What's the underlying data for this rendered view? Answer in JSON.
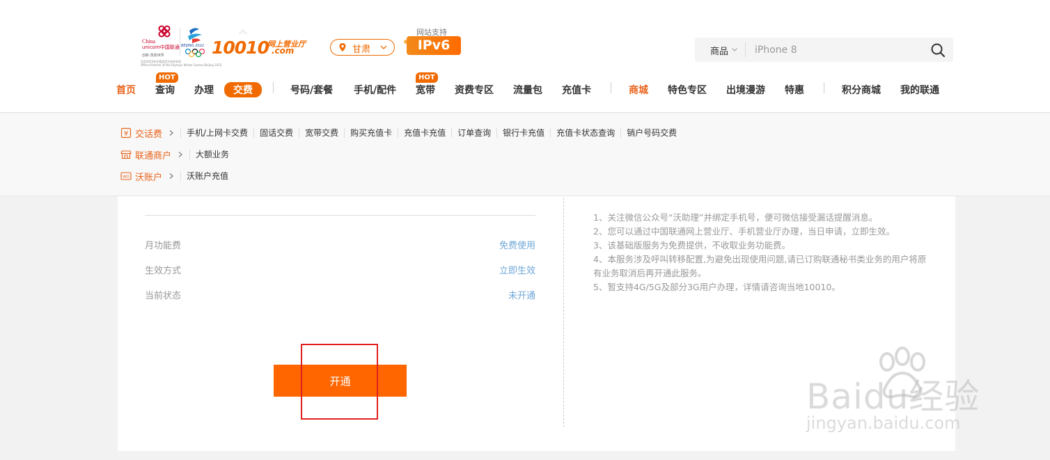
{
  "header": {
    "logo": {
      "china": "China",
      "unicom": "unicom中国联通",
      "slogan": "创新·改变世界",
      "beijing": "BEIJING 2022",
      "partner_cn": "北京2022年冬奥会官方合作伙伴",
      "partner_en": "Official Partner of the Olympic Winter Games Beijing 2022",
      "brand_number": "10010",
      "brand_sub": "网上营业厅",
      "brand_com": ".com"
    },
    "region": {
      "label": "甘肃"
    },
    "ipv6": {
      "top": "网站支持",
      "badge": "IPv6"
    },
    "search": {
      "category": "商品",
      "placeholder": "iPhone 8"
    },
    "nav": {
      "home": "首页",
      "query": "查询",
      "handle": "办理",
      "pay": "交费",
      "number_plan": "号码/套餐",
      "phone": "手机/配件",
      "broadband": "宽带",
      "tariff": "资费专区",
      "data_pack": "流量包",
      "recharge_card": "充值卡",
      "mall": "商城",
      "special": "特色专区",
      "roaming": "出境漫游",
      "deals": "特惠",
      "points_mall": "积分商城",
      "my_unicom": "我的联通",
      "hot_badge": "HOT"
    }
  },
  "submenu": {
    "row1": {
      "title": "交话费",
      "links": [
        "手机/上网卡交费",
        "固话交费",
        "宽带交费",
        "购买充值卡",
        "充值卡充值",
        "订单查询",
        "银行卡充值",
        "充值卡状态查询",
        "销户号码交费"
      ]
    },
    "row2": {
      "title": "联通商户",
      "links": [
        "大额业务"
      ]
    },
    "row3": {
      "title": "沃账户",
      "links": [
        "沃账户充值"
      ]
    }
  },
  "service": {
    "rows": [
      {
        "label": "月功能费",
        "value": "免费使用"
      },
      {
        "label": "生效方式",
        "value": "立即生效"
      },
      {
        "label": "当前状态",
        "value": "未开通"
      }
    ],
    "button": "开通"
  },
  "notes": [
    "1、关注微信公众号“沃助理”并绑定手机号，便可微信接受漏话提醒消息。",
    "2、您可以通过中国联通网上营业厅、手机营业厅办理，当日申请，立即生效。",
    "3、该基础版服务为免费提供，不收取业务功能费。",
    "4、本服务涉及呼叫转移配置,为避免出现使用问题,请已订购联通秘书类业务的用户将原有业务取消后再开通此服务。",
    "5、暂支持4G/5G及部分3G用户办理，详情请咨询当地10010。"
  ],
  "watermark": {
    "text": "Baidu经验",
    "url": "jingyan.baidu.com"
  },
  "colors": {
    "accent": "#f06a00",
    "link_blue": "#6fa7d9",
    "muted": "#999999",
    "highlight_box": "#e02020"
  }
}
